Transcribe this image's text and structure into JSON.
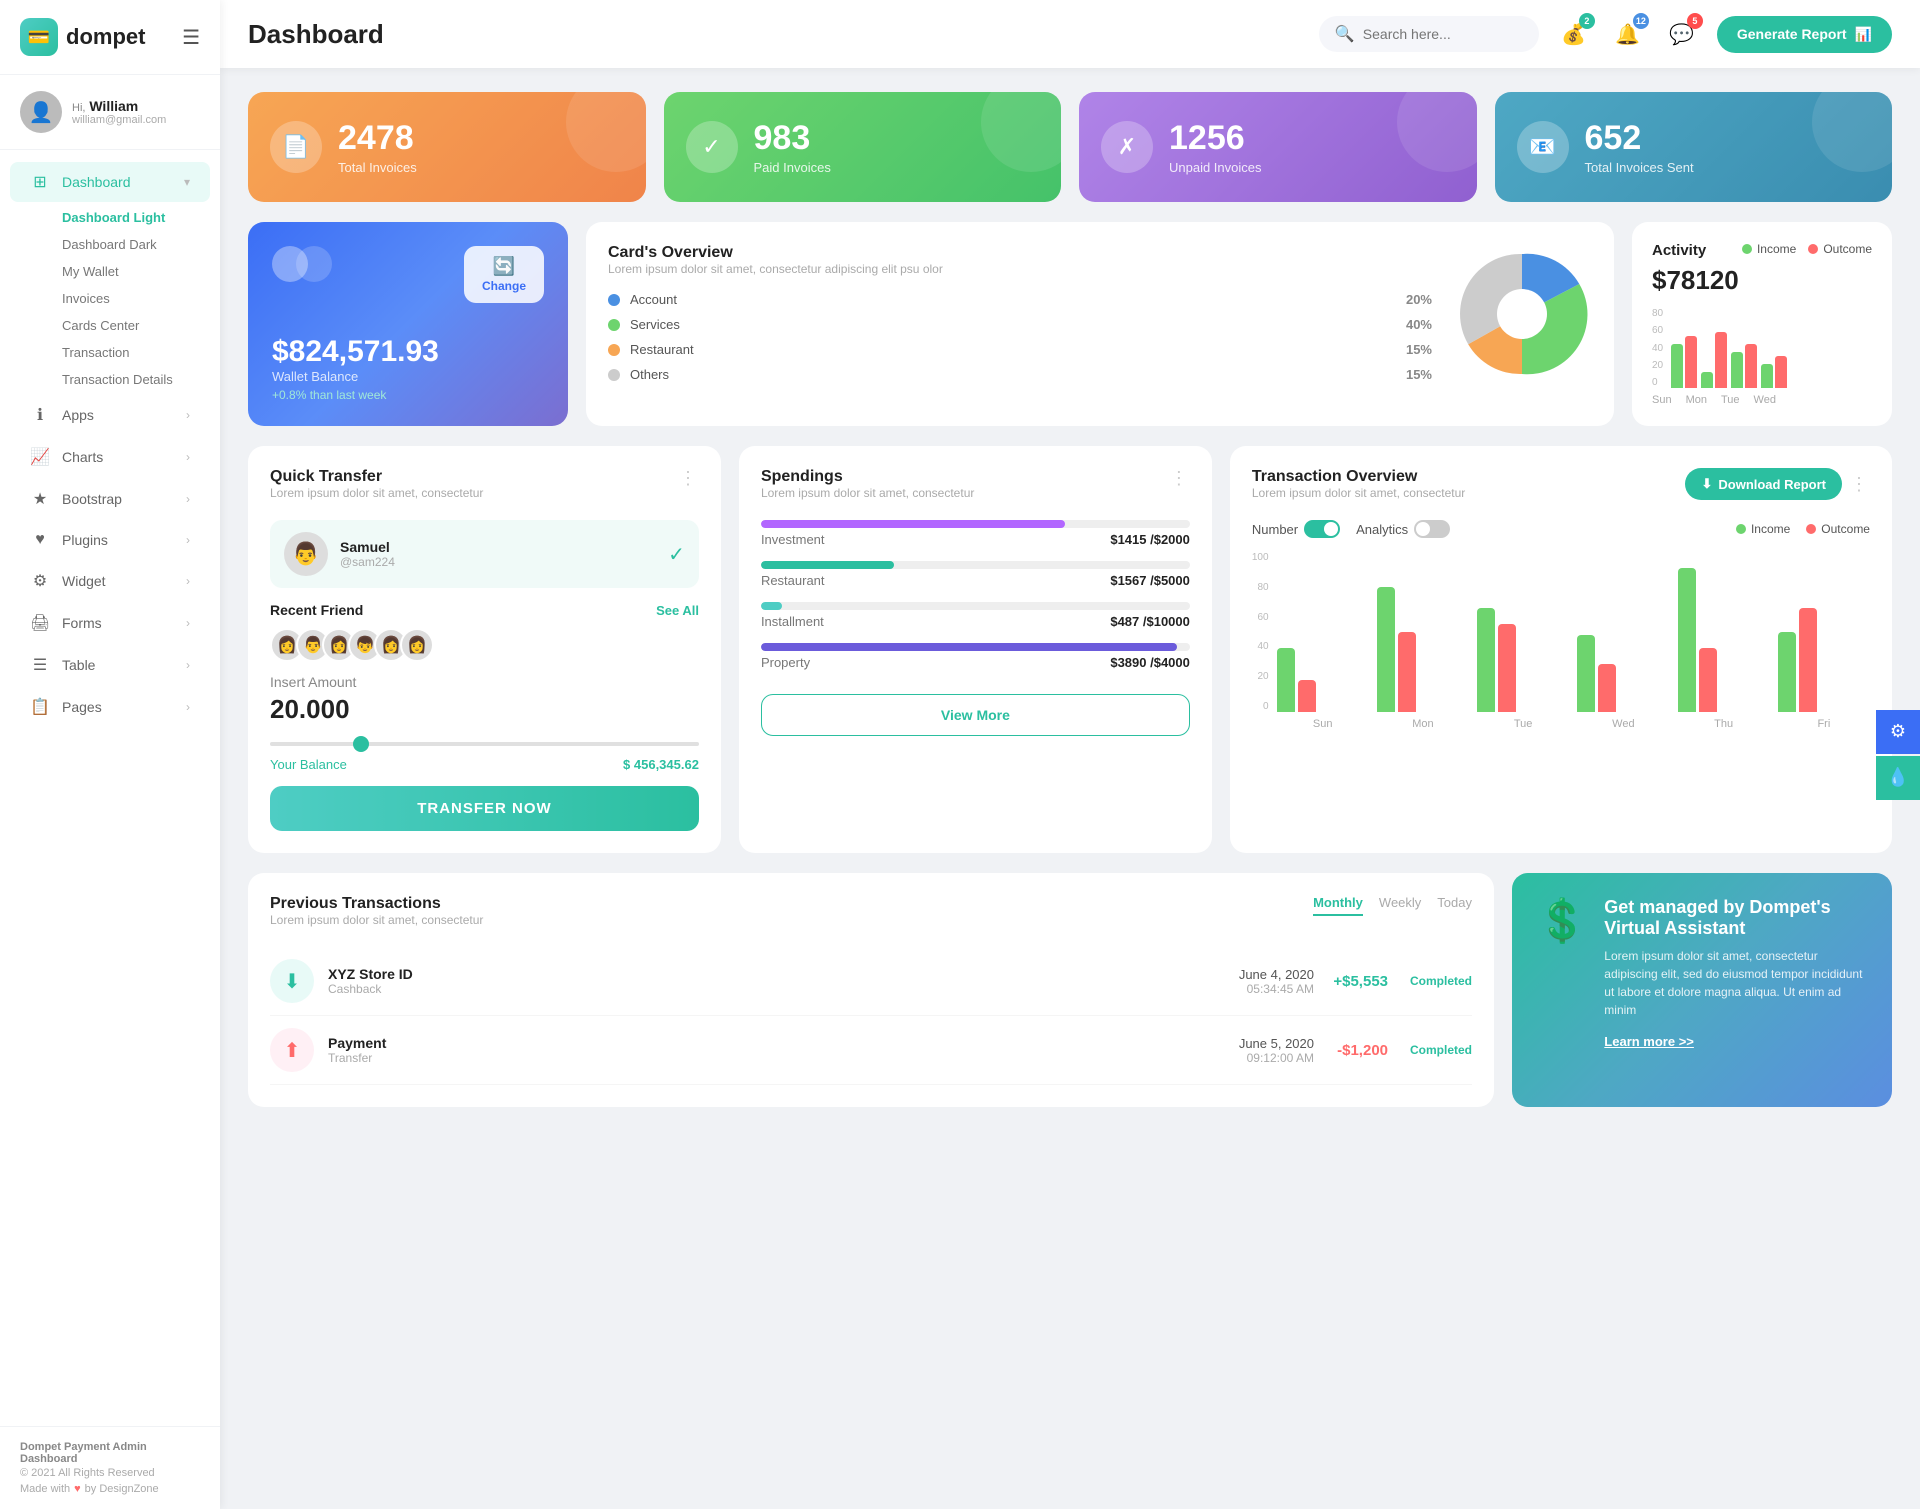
{
  "sidebar": {
    "logo": "dompet",
    "logo_icon": "💳",
    "hamburger_icon": "☰",
    "user": {
      "greeting": "Hi,",
      "name": "William",
      "email": "william@gmail.com",
      "avatar_icon": "👤"
    },
    "nav": [
      {
        "id": "dashboard",
        "label": "Dashboard",
        "icon": "⊞",
        "active": true,
        "arrow": "▾",
        "submenu": [
          "Dashboard Light",
          "Dashboard Dark",
          "My Wallet",
          "Invoices",
          "Cards Center",
          "Transaction",
          "Transaction Details"
        ],
        "active_sub": "Dashboard Light"
      },
      {
        "id": "apps",
        "label": "Apps",
        "icon": "ℹ",
        "active": false,
        "arrow": "›"
      },
      {
        "id": "charts",
        "label": "Charts",
        "icon": "📈",
        "active": false,
        "arrow": "›"
      },
      {
        "id": "bootstrap",
        "label": "Bootstrap",
        "icon": "★",
        "active": false,
        "arrow": "›"
      },
      {
        "id": "plugins",
        "label": "Plugins",
        "icon": "♥",
        "active": false,
        "arrow": "›"
      },
      {
        "id": "widget",
        "label": "Widget",
        "icon": "⚙",
        "active": false,
        "arrow": "›"
      },
      {
        "id": "forms",
        "label": "Forms",
        "icon": "🖨",
        "active": false,
        "arrow": "›"
      },
      {
        "id": "table",
        "label": "Table",
        "icon": "☰",
        "active": false,
        "arrow": "›"
      },
      {
        "id": "pages",
        "label": "Pages",
        "icon": "📋",
        "active": false,
        "arrow": "›"
      }
    ],
    "footer": {
      "brand": "Dompet Payment Admin Dashboard",
      "year": "© 2021 All Rights Reserved",
      "made_with": "Made with",
      "heart": "♥",
      "by": "by DesignZone"
    }
  },
  "topbar": {
    "title": "Dashboard",
    "search_placeholder": "Search here...",
    "search_icon": "🔍",
    "icons": [
      {
        "id": "wallet",
        "icon": "💰",
        "badge": "2",
        "badge_color": "green"
      },
      {
        "id": "bell",
        "icon": "🔔",
        "badge": "12",
        "badge_color": "blue"
      },
      {
        "id": "chat",
        "icon": "💬",
        "badge": "5",
        "badge_color": "red"
      }
    ],
    "generate_btn": "Generate Report",
    "generate_icon": "📊"
  },
  "stat_cards": [
    {
      "id": "total",
      "number": "2478",
      "label": "Total Invoices",
      "icon": "📄",
      "color": "orange"
    },
    {
      "id": "paid",
      "number": "983",
      "label": "Paid Invoices",
      "icon": "✓",
      "color": "green"
    },
    {
      "id": "unpaid",
      "number": "1256",
      "label": "Unpaid Invoices",
      "icon": "✗",
      "color": "purple"
    },
    {
      "id": "sent",
      "number": "652",
      "label": "Total Invoices Sent",
      "icon": "📧",
      "color": "teal"
    }
  ],
  "wallet_card": {
    "balance": "$824,571.93",
    "label": "Wallet Balance",
    "change": "+0.8% than last week",
    "refresh_label": "Change"
  },
  "cards_overview": {
    "title": "Card's Overview",
    "subtitle": "Lorem ipsum dolor sit amet, consectetur adipiscing elit psu olor",
    "legend": [
      {
        "label": "Account",
        "pct": "20%",
        "color": "#4a90e2"
      },
      {
        "label": "Services",
        "pct": "40%",
        "color": "#6dd46e"
      },
      {
        "label": "Restaurant",
        "pct": "15%",
        "color": "#f7a654"
      },
      {
        "label": "Others",
        "pct": "15%",
        "color": "#ccc"
      }
    ]
  },
  "activity": {
    "title": "Activity",
    "amount": "$78120",
    "legend": [
      {
        "label": "Income",
        "color": "#6dd46e"
      },
      {
        "label": "Outcome",
        "color": "#ff6b6b"
      }
    ],
    "bars": [
      {
        "day": "Sun",
        "income": 55,
        "outcome": 65
      },
      {
        "day": "Mon",
        "income": 20,
        "outcome": 70
      },
      {
        "day": "Tue",
        "income": 45,
        "outcome": 55
      },
      {
        "day": "Wed",
        "income": 30,
        "outcome": 40
      }
    ]
  },
  "quick_transfer": {
    "title": "Quick Transfer",
    "subtitle": "Lorem ipsum dolor sit amet, consectetur",
    "user": {
      "name": "Samuel",
      "handle": "@sam224",
      "avatar": "👨"
    },
    "recent_label": "Recent Friend",
    "see_all": "See All",
    "avatars": [
      "👩",
      "👨",
      "👩",
      "👦",
      "👩",
      "👩"
    ],
    "amount_label": "Insert Amount",
    "amount": "20.000",
    "balance_label": "Your Balance",
    "balance": "$ 456,345.62",
    "transfer_btn": "TRANSFER NOW"
  },
  "spendings": {
    "title": "Spendings",
    "subtitle": "Lorem ipsum dolor sit amet, consectetur",
    "items": [
      {
        "label": "Investment",
        "current": 1415,
        "max": 2000,
        "color": "#b266ff",
        "pct": 71
      },
      {
        "label": "Restaurant",
        "current": 1567,
        "max": 5000,
        "color": "#2bbfa0",
        "pct": 31
      },
      {
        "label": "Installment",
        "current": 487,
        "max": 10000,
        "color": "#4ecdc4",
        "pct": 5
      },
      {
        "label": "Property",
        "current": 3890,
        "max": 4000,
        "color": "#6b5bdb",
        "pct": 97
      }
    ],
    "view_more": "View More"
  },
  "transaction_overview": {
    "title": "Transaction Overview",
    "subtitle": "Lorem ipsum dolor sit amet, consectetur",
    "download_btn": "Download Report",
    "toggles": [
      {
        "label": "Number",
        "active": true
      },
      {
        "label": "Analytics",
        "active": false
      }
    ],
    "legend": [
      {
        "label": "Income",
        "color": "#6dd46e"
      },
      {
        "label": "Outcome",
        "color": "#ff6b6b"
      }
    ],
    "bars": [
      {
        "day": "Sun",
        "income": 40,
        "outcome": 20
      },
      {
        "day": "Mon",
        "income": 78,
        "outcome": 50
      },
      {
        "day": "Tue",
        "income": 65,
        "outcome": 55
      },
      {
        "day": "Wed",
        "income": 48,
        "outcome": 30
      },
      {
        "day": "Thu",
        "income": 90,
        "outcome": 40
      },
      {
        "day": "Fri",
        "income": 50,
        "outcome": 65
      }
    ],
    "y_labels": [
      "0",
      "20",
      "40",
      "60",
      "80",
      "100"
    ]
  },
  "previous_transactions": {
    "title": "Previous Transactions",
    "subtitle": "Lorem ipsum dolor sit amet, consectetur",
    "filters": [
      "Monthly",
      "Weekly",
      "Today"
    ],
    "active_filter": "Monthly",
    "rows": [
      {
        "name": "XYZ Store ID",
        "type": "Cashback",
        "date": "June 4, 2020",
        "time": "05:34:45 AM",
        "amount": "+$5,553",
        "status": "Completed",
        "icon": "⬇"
      }
    ]
  },
  "virtual_assistant": {
    "title": "Get managed by Dompet's Virtual Assistant",
    "desc": "Lorem ipsum dolor sit amet, consectetur adipiscing elit, sed do eiusmod tempor incididunt ut labore et dolore magna aliqua. Ut enim ad minim",
    "link": "Learn more >>",
    "icon": "💲"
  },
  "right_side_btns": [
    {
      "id": "settings",
      "icon": "⚙"
    },
    {
      "id": "water",
      "icon": "💧"
    }
  ]
}
